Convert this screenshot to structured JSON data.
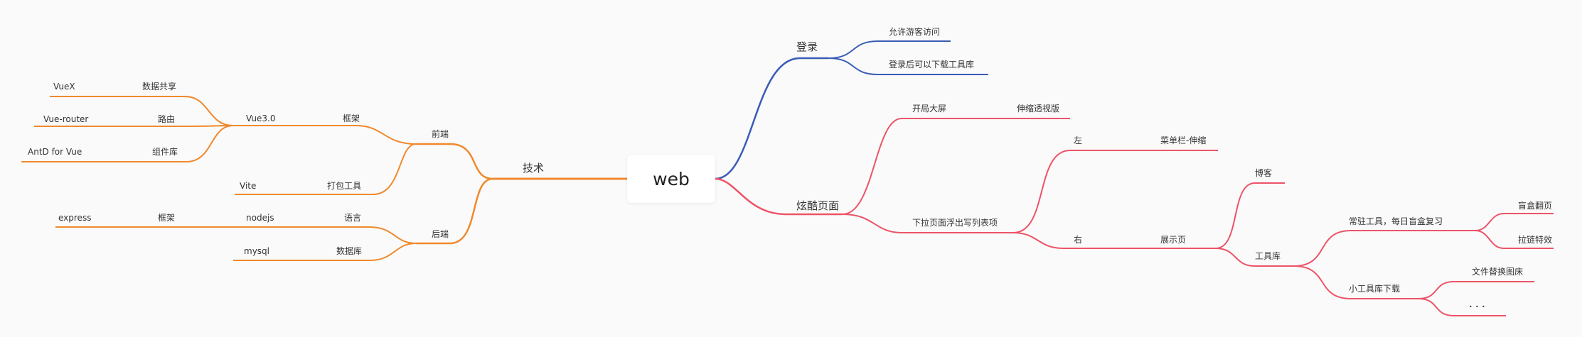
{
  "root": "web",
  "colors": {
    "orange": "#f0892d",
    "blue": "#3a5cb7",
    "red": "#ec5468"
  },
  "labels": {
    "login": "登录",
    "guest": "允许游客访问",
    "download": "登录后可以下载工具库",
    "cool_page": "炫酷页面",
    "big_screen": "开局大屏",
    "perspective": "伸缩透视版",
    "dropdown": "下拉页面浮出写列表项",
    "left": "左",
    "menu": "菜单栏-伸缩",
    "right": "右",
    "showcase": "展示页",
    "blog": "博客",
    "toolbox": "工具库",
    "daily": "常驻工具，每日盲盒复习",
    "blindbox": "盲盒翻页",
    "zipper": "拉链特效",
    "small_tools": "小工具库下载",
    "file_replace": "文件替换图床",
    "more": "．．．",
    "tech": "技术",
    "frontend": "前端",
    "vue3": "Vue3.0",
    "framework_fe": "框架",
    "vuex": "VueX",
    "data_share": "数据共享",
    "vue_router": "Vue-router",
    "routing": "路由",
    "antd": "AntD for Vue",
    "component_lib": "组件库",
    "vite": "Vite",
    "bundler": "打包工具",
    "backend": "后端",
    "nodejs": "nodejs",
    "language": "语言",
    "express": "express",
    "framework_be": "框架",
    "mysql": "mysql",
    "database": "数据库"
  }
}
